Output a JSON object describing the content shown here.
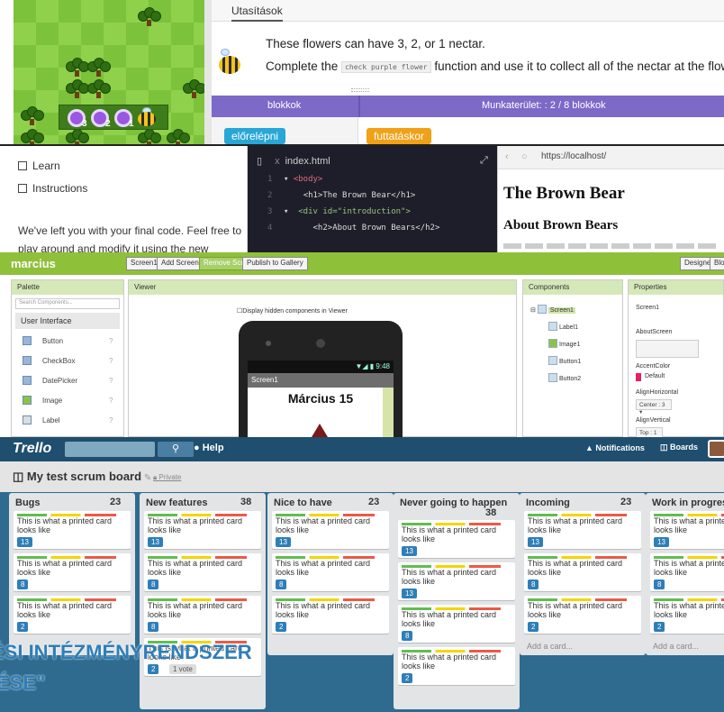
{
  "panel1": {
    "tab": "Utasítások",
    "instr1": "These flowers can have 3, 2, or 1 nectar.",
    "instr2a": "Complete the",
    "instr2code": "check purple flower",
    "instr2b": "function and use it to collect all of the nectar at the flowers.",
    "bar_left": "blokkok",
    "bar_right": "Munkaterület: : 2 / 8 blokkok",
    "block1": "előrelépni",
    "block2": "futtatáskor",
    "nectar": [
      "3",
      "2",
      "1"
    ]
  },
  "panel2": {
    "learn": "Learn",
    "instructions": "Instructions",
    "text": "We've left you with your final code. Feel free to play around and modify it using the new elements you've",
    "file": "index.html",
    "close": "x",
    "code": [
      {
        "n": "1",
        "pre": "▾ ",
        "t": "<body>",
        "c": "tg"
      },
      {
        "n": "2",
        "pre": "    ",
        "t": "<h1>The Brown Bear</h1>",
        "c": "tg"
      },
      {
        "n": "3",
        "pre": "▾  ",
        "t": "<div id=\"introduction\">",
        "c": "tg"
      },
      {
        "n": "4",
        "pre": "      ",
        "t": "<h2>About Brown Bears</h2>",
        "c": "tg"
      }
    ],
    "url": "https://localhost/",
    "h1": "The Brown Bear",
    "h2": "About Brown Bears"
  },
  "panel3": {
    "title": "marcius",
    "btn_screen": "Screen1 ▾",
    "btn_add": "Add Screen...",
    "btn_remove": "Remove Screen",
    "btn_publish": "Publish to Gallery",
    "btn_designer": "Designer",
    "btn_blocks": "Blocks",
    "palette": "Palette",
    "search": "Search Components...",
    "ui": "User Interface",
    "items": [
      "Button",
      "CheckBox",
      "DatePicker",
      "Image",
      "Label"
    ],
    "viewer": "Viewer",
    "hidden": "☐Display hidden components in Viewer",
    "status": "▼◢ ▮ 9:48",
    "screenbar": "Screen1",
    "label": "Március 15",
    "components": "Components",
    "comp_screen": "Screen1",
    "comp_items": [
      "Label1",
      "Image1",
      "Button1",
      "Button2"
    ],
    "properties": "Properties",
    "prop_screen": "Screen1",
    "about": "AboutScreen",
    "accent": "AccentColor",
    "accent_val": "Default",
    "alignh": "AlignHorizontal",
    "alignh_val": "Center : 3 ▾",
    "alignv": "AlignVertical",
    "alignv_val": "Top : 1 ▾"
  },
  "panel4": {
    "logo": "Trello",
    "help": "Help",
    "notifications": "Notifications",
    "boards": "Boards",
    "board": "My test scrum board",
    "private": "Private",
    "card_text": "This is what a printed card looks like",
    "add": "Add a card...",
    "votes": "1 vote",
    "lists": [
      {
        "name": "Bugs",
        "count": "23",
        "badges": [
          "13",
          "8",
          "2"
        ]
      },
      {
        "name": "New features",
        "count": "38",
        "badges": [
          "13",
          "8",
          "8",
          "2"
        ]
      },
      {
        "name": "Nice to have",
        "count": "23",
        "badges": [
          "13",
          "8",
          "2"
        ]
      },
      {
        "name": "Never going to happen",
        "count": "38",
        "badges": [
          "13",
          "13",
          "8",
          "2"
        ]
      },
      {
        "name": "Incoming",
        "count": "23",
        "badges": [
          "13",
          "8",
          "2"
        ]
      },
      {
        "name": "Work in progress",
        "count": "",
        "badges": [
          "13",
          "8",
          "2"
        ]
      }
    ],
    "overlay1": "ÉSI INTÉZMÉNYRENDSZER",
    "overlay2": "ÉSE\""
  }
}
